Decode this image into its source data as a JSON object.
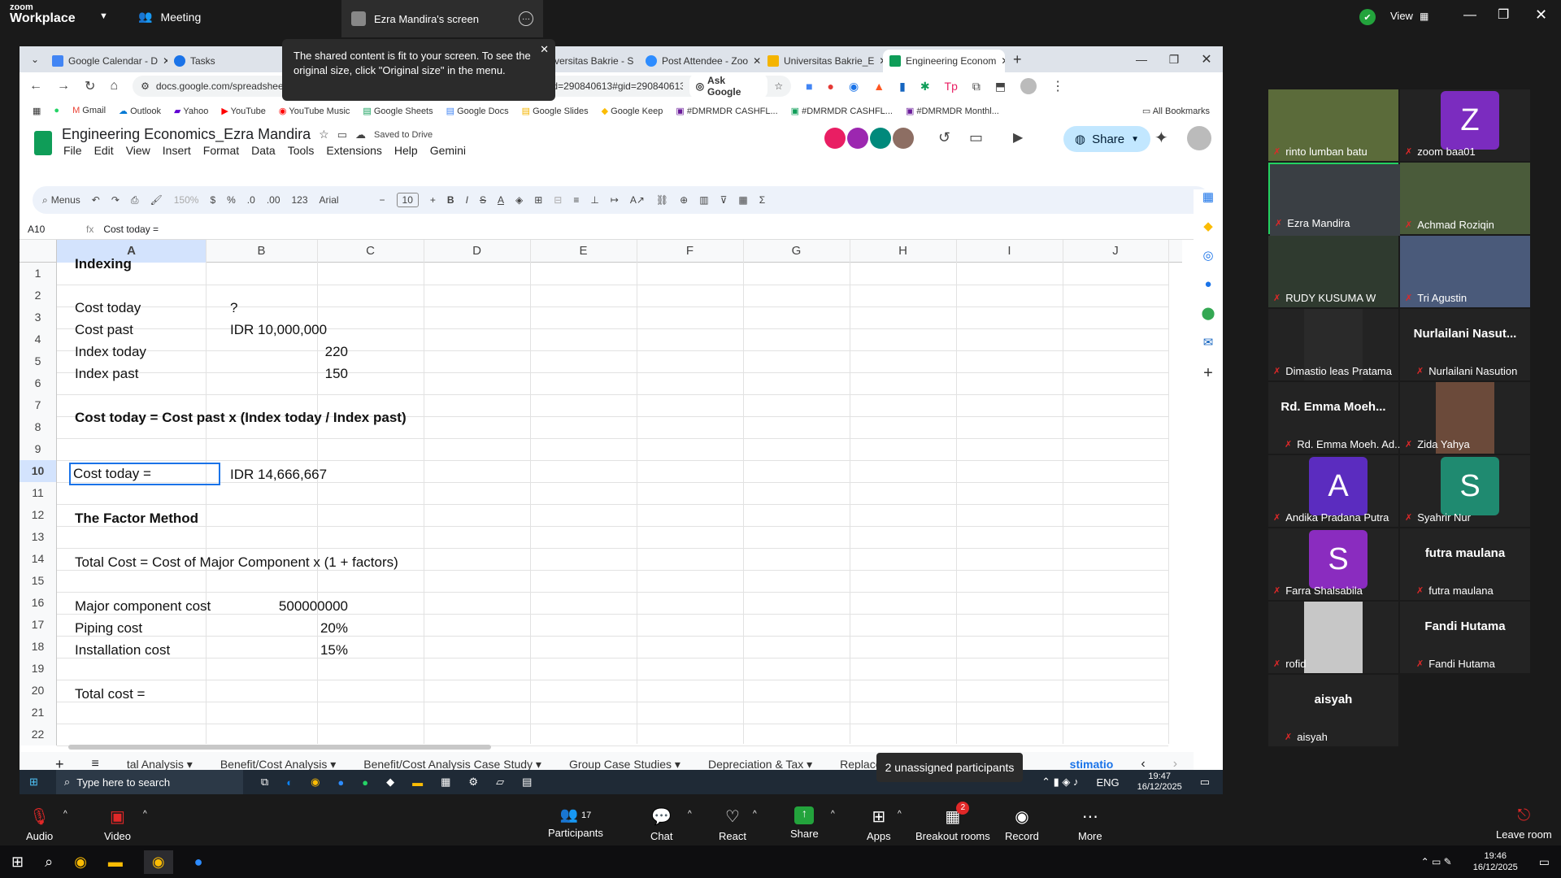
{
  "zoom": {
    "app": "Workplace",
    "brand": "zoom",
    "meeting": "Meeting",
    "screen_title": "Ezra Mandira's screen",
    "view": "View",
    "notice": "The shared content is fit to your screen. To see the original size, click \"Original size\" in the menu."
  },
  "browser": {
    "tabs": [
      "Google Calendar - D",
      "Tasks",
      "",
      "",
      "Universitas Bakrie - S",
      "Post Attendee - Zoo",
      "Universitas Bakrie_E",
      "Engineering Econom"
    ],
    "url": "docs.google.com/spreadsheets/d/12pfP-ORnahRDT-lsLXEMSIAIyBhefbdnTZjOGqkwzdit?gid=290840613#gid=290840613",
    "ask_google": "Ask Google",
    "bookmarks": [
      "Gmail",
      "Outlook",
      "Yahoo",
      "YouTube",
      "YouTube Music",
      "Google Sheets",
      "Google Docs",
      "Google Slides",
      "Google Keep",
      "#DMRMDR CASHFL...",
      "#DMRMDR CASHFL...",
      "#DMRMDR Monthl...",
      "All Bookmarks"
    ]
  },
  "sheet": {
    "title": "Engineering Economics_Ezra Mandira",
    "saved": "Saved to Drive",
    "menus": [
      "File",
      "Edit",
      "View",
      "Insert",
      "Format",
      "Data",
      "Tools",
      "Extensions",
      "Help",
      "Gemini"
    ],
    "share": "Share",
    "search": "Menus",
    "zoom": "150%",
    "font": "Arial",
    "fontsize": "10",
    "cellref": "A10",
    "formula": "Cost today =",
    "numfmt": [
      "$",
      "%",
      ".0",
      ".00",
      "123"
    ],
    "cols": [
      "A",
      "B",
      "C",
      "D",
      "E",
      "F",
      "G",
      "H",
      "I",
      "J"
    ],
    "rows": [
      "1",
      "2",
      "3",
      "4",
      "5",
      "6",
      "7",
      "8",
      "9",
      "10",
      "11",
      "12",
      "13",
      "14",
      "15",
      "16",
      "17",
      "18",
      "19",
      "20",
      "21",
      "22"
    ],
    "cells": {
      "a1": "Indexing",
      "a3": "Cost today",
      "b3": "?",
      "a4": "Cost past",
      "b4": "IDR 10,000,000",
      "a5": "Index today",
      "b5": "220",
      "a6": "Index past",
      "b6": "150",
      "a8": "Cost today = Cost past x (Index today / Index past)",
      "a10": "Cost today =",
      "b10": "IDR 14,666,667",
      "a12": "The Factor Method",
      "a14": "Total Cost = Cost of Major Component x (1 + factors)",
      "a16": "Major component cost",
      "b16": "500000000",
      "a17": "Piping cost",
      "b17": "20%",
      "a18": "Installation cost",
      "b18": "15%",
      "a20": "Total cost ="
    },
    "tabs": [
      "tal Analysis",
      "Benefit/Cost Analysis",
      "Benefit/Cost Analysis Case Study",
      "Group Case Studies",
      "Depreciation & Tax",
      "Replacement Retentio",
      "stimatio"
    ]
  },
  "shared_taskbar": {
    "search": "Type here to search",
    "lang": "ENG",
    "time": "19:47",
    "date": "16/12/2025",
    "unassigned": "2 unassigned participants"
  },
  "participants": [
    {
      "name": "rinto lumban batu",
      "label": ""
    },
    {
      "name": "zoom baa01",
      "label": "Z"
    },
    {
      "name": "Ezra Mandira",
      "label": ""
    },
    {
      "name": "Achmad Roziqin",
      "label": ""
    },
    {
      "name": "RUDY KUSUMA W",
      "label": ""
    },
    {
      "name": "Tri Agustin",
      "label": ""
    },
    {
      "name": "Dimastio leas Pratama",
      "label": ""
    },
    {
      "name": "Nurlailani Nasution",
      "label": "Nurlailani  Nasut..."
    },
    {
      "name": "Rd. Emma Moeh. Ad...",
      "label": "Rd. Emma  Moeh..."
    },
    {
      "name": "Zida Yahya",
      "label": ""
    },
    {
      "name": "Andika Pradana Putra",
      "label": "A"
    },
    {
      "name": "Syahrir Nur",
      "label": "S"
    },
    {
      "name": "Farra Shalsabila",
      "label": "S"
    },
    {
      "name": "futra maulana",
      "label": "futra maulana"
    },
    {
      "name": "rofid",
      "label": ""
    },
    {
      "name": "Fandi Hutama",
      "label": "Fandi Hutama"
    },
    {
      "name": "aisyah",
      "label": "aisyah"
    }
  ],
  "controls": {
    "audio": "Audio",
    "video": "Video",
    "participants": "Participants",
    "participants_count": "17",
    "chat": "Chat",
    "react": "React",
    "share": "Share",
    "apps": "Apps",
    "breakout": "Breakout rooms",
    "breakout_badge": "2",
    "record": "Record",
    "more": "More",
    "leave": "Leave room"
  },
  "taskbar": {
    "time": "19:46",
    "date": "16/12/2025"
  }
}
